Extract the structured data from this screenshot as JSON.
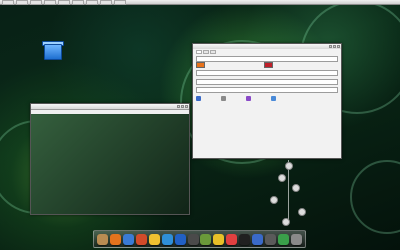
{
  "top_panel": {
    "items": [
      "",
      "",
      "",
      "",
      "",
      "",
      "",
      "",
      ""
    ],
    "clock": ""
  },
  "desktop": {
    "trash_label": ""
  },
  "terminal": {
    "title": "",
    "menu": [
      "",
      "",
      "",
      "",
      ""
    ],
    "prompt": ""
  },
  "preferences": {
    "title": "",
    "tabs": [
      "",
      "",
      ""
    ],
    "sections": [
      {
        "heading": "",
        "rows": [
          {
            "label": "",
            "color": "#e8731c"
          },
          {
            "label": "",
            "color": "#c0202a"
          }
        ]
      },
      {
        "heading": ""
      },
      {
        "heading": ""
      }
    ],
    "icon_labels": [
      "",
      "",
      "",
      ""
    ]
  },
  "dock": {
    "items": [
      {
        "name": "home-folder-icon",
        "color": "#b88c52"
      },
      {
        "name": "firefox-icon",
        "color": "#e2731d"
      },
      {
        "name": "network-icon",
        "color": "#3a7bd5"
      },
      {
        "name": "music-player-icon",
        "color": "#d24b2a"
      },
      {
        "name": "photo-icon",
        "color": "#f0c030"
      },
      {
        "name": "chat-icon",
        "color": "#2f8fd8"
      },
      {
        "name": "browser-icon",
        "color": "#2160c4"
      },
      {
        "name": "media-icon",
        "color": "#4a4a4a"
      },
      {
        "name": "office-icon",
        "color": "#6a9a3a"
      },
      {
        "name": "pen-icon",
        "color": "#e8c028"
      },
      {
        "name": "notes-icon",
        "color": "#e04040"
      },
      {
        "name": "terminal-icon",
        "color": "#202020"
      },
      {
        "name": "system-icon",
        "color": "#3a6ac8"
      },
      {
        "name": "display-icon",
        "color": "#5a5a5a"
      },
      {
        "name": "download-icon",
        "color": "#3aa04a"
      },
      {
        "name": "trash-icon",
        "color": "#8a8a8a"
      }
    ]
  }
}
